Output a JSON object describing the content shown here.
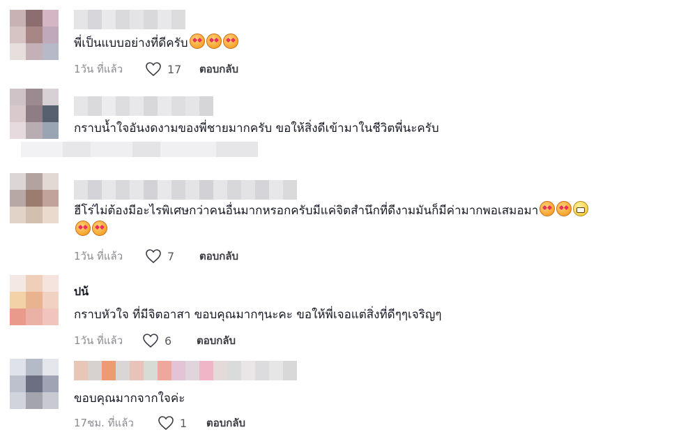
{
  "comments": [
    {
      "text": "พี่เป็นแบบอย่างที่ดีครับ",
      "emoji": [
        "smiling-face-with-hearts",
        "smiling-face-with-hearts",
        "smiling-face-with-hearts"
      ],
      "time": "1วัน ที่แล้ว",
      "likes": "17",
      "reply": "ตอบกลับ"
    },
    {
      "text": "กราบน้ำใจอันงดงามของพี่ชายมากครับ ขอให้สิ่งดีเข้ามาในชีวิตพี่นะครับ"
    },
    {
      "text": "ฮีโร่ไม่ต้องมีอะไรพิเศษกว่าคนอื่นมากหรอกครับมีแค่จิตสำนึกที่ดีงามมันก็มีค่ามากพอเสมอมา",
      "emoji": [
        "smiling-face-with-hearts",
        "smiling-face-with-hearts",
        "grinning-face",
        "smiling-face-with-hearts",
        "smiling-face-with-hearts"
      ],
      "time": "1วัน ที่แล้ว",
      "likes": "7",
      "reply": "ตอบกลับ"
    },
    {
      "author": "ปน้",
      "text": "กราบหัวใจ ที่มีจิตอาสา ขอบคุณมากๆนะคะ ขอให้พี่เจอแต่สิ่งที่ดีๆๆเจริญๆ",
      "time": "1วัน ที่แล้ว",
      "likes": "6",
      "reply": "ตอบกลับ"
    },
    {
      "text": "ขอบคุณมากจากใจค่ะ",
      "time": "17ชม. ที่แล้ว",
      "likes": "1",
      "reply": "ตอบกลับ"
    }
  ],
  "colors": {
    "text": "#161823",
    "meta": "#8a8b91",
    "reply": "#3a3b41",
    "background": "#ffffff"
  }
}
